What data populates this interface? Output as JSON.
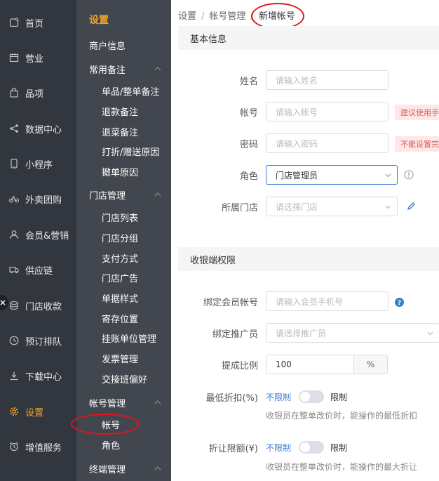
{
  "rail": {
    "items": [
      {
        "label": "首页",
        "icon": "home-icon"
      },
      {
        "label": "营业",
        "icon": "calendar-icon"
      },
      {
        "label": "品项",
        "icon": "bag-icon"
      },
      {
        "label": "数据中心",
        "icon": "share-icon"
      },
      {
        "label": "小程序",
        "icon": "phone-icon"
      },
      {
        "label": "外卖团购",
        "icon": "bike-icon"
      },
      {
        "label": "会员&营销",
        "icon": "user-icon"
      },
      {
        "label": "供应链",
        "icon": "truck-icon"
      },
      {
        "label": "门店收款",
        "icon": "coins-icon"
      },
      {
        "label": "预订排队",
        "icon": "clock-icon"
      },
      {
        "label": "下载中心",
        "icon": "download-icon"
      },
      {
        "label": "设置",
        "icon": "gear-icon",
        "active": true
      },
      {
        "label": "增值服务",
        "icon": "alarm-icon"
      }
    ],
    "collapse_icon": "x-icon",
    "active_color": "#f5a623"
  },
  "sub": {
    "title": "设置",
    "merchant": "商户信息",
    "group_notes": "常用备注",
    "notes": [
      "单品/整单备注",
      "退款备注",
      "退菜备注",
      "打折/赠送原因",
      "撤单原因"
    ],
    "group_store": "门店管理",
    "store": [
      "门店列表",
      "门店分组",
      "支付方式",
      "门店广告",
      "单据样式",
      "寄存位置",
      "挂账单位管理",
      "发票管理",
      "交接班偏好"
    ],
    "group_account": "帐号管理",
    "account": [
      "帐号",
      "角色"
    ],
    "group_terminal": "终端管理"
  },
  "breadcrumb": {
    "items": [
      "设置",
      "帐号管理"
    ],
    "current": "新增帐号",
    "separator": "/"
  },
  "basic": {
    "title": "基本信息",
    "name": {
      "label": "姓名",
      "placeholder": "请输入姓名"
    },
    "account": {
      "label": "帐号",
      "placeholder": "请输入帐号",
      "warning": "建议使用手机号"
    },
    "password": {
      "label": "密码",
      "placeholder": "请输入密码",
      "warning": "不能设置完全相同的"
    },
    "role": {
      "label": "角色",
      "value": "门店管理员",
      "info_icon": "info-circle-icon"
    },
    "store": {
      "label": "所属门店",
      "placeholder": "请选择门店",
      "edit_icon": "pencil-icon"
    }
  },
  "cashier": {
    "title": "收银端权限",
    "member": {
      "label": "绑定会员帐号",
      "placeholder": "请输入会员手机号",
      "help_icon": "question-icon"
    },
    "promoter": {
      "label": "绑定推广员",
      "placeholder": "请选择推广员"
    },
    "commission": {
      "label": "提成比例",
      "value": "100",
      "unit": "%"
    },
    "min_discount": {
      "label": "最低折扣(%)",
      "unlimited": "不限制",
      "limit": "限制",
      "hint": "收银员在整单改价时，能操作的最低折扣"
    },
    "max_discount": {
      "label": "折让限额(¥)",
      "unlimited": "不限制",
      "limit": "限制",
      "hint": "收银员在整单改价时，能操作的最大折让"
    }
  },
  "annotation_color": "#e0151b",
  "accent": "#3a7bd5"
}
